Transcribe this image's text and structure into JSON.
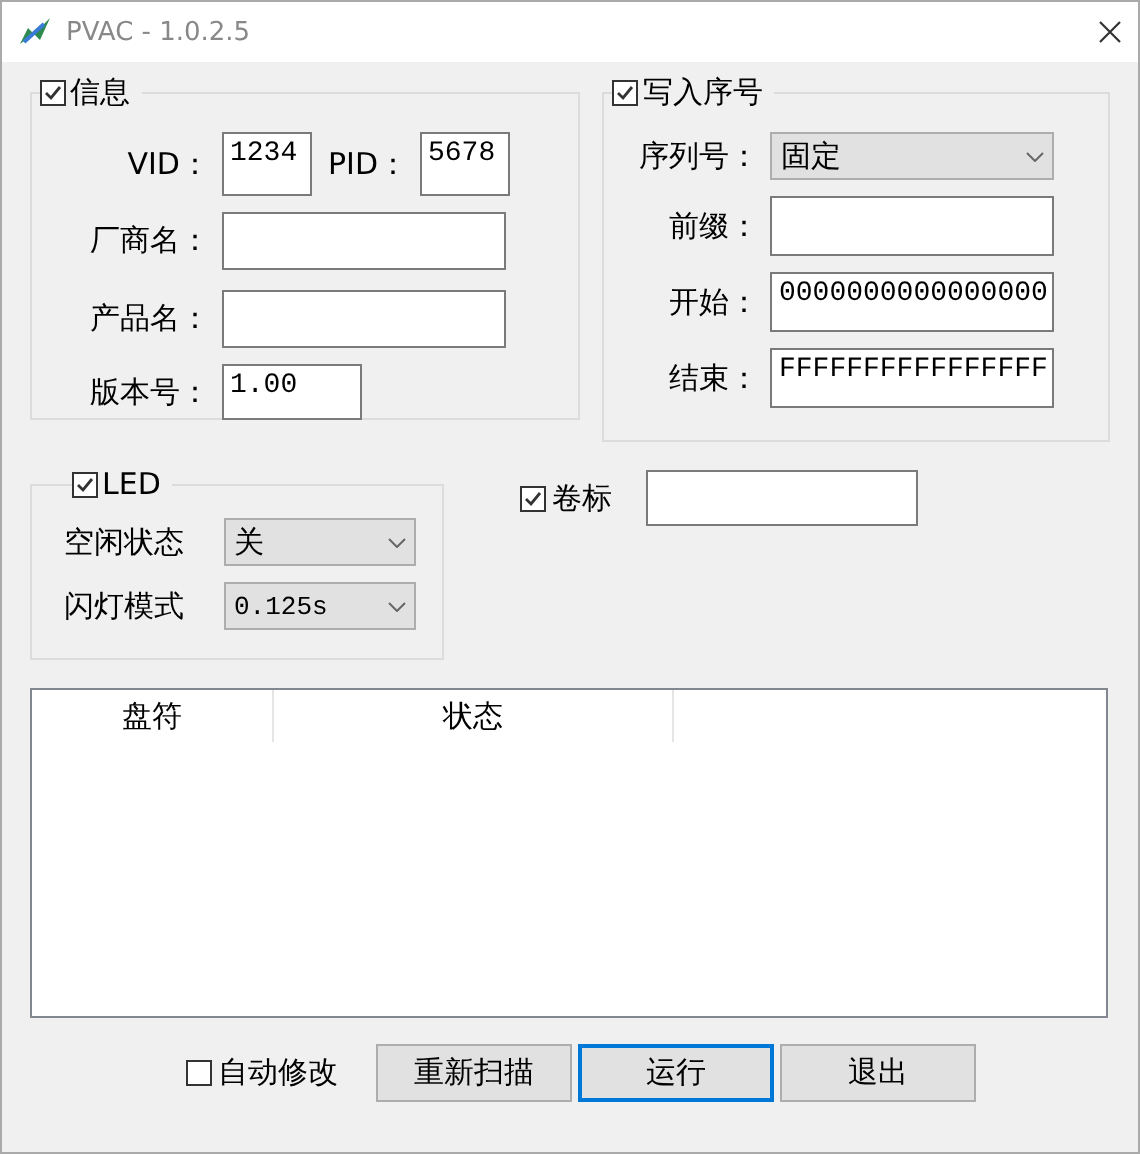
{
  "window": {
    "title": "PVAC - 1.0.2.5"
  },
  "info": {
    "label": "信息",
    "checked": true,
    "vid": {
      "label": "VID：",
      "value": "1234"
    },
    "pid": {
      "label": "PID：",
      "value": "5678"
    },
    "fields": [
      {
        "label": "厂商名："
      },
      {
        "label": "产品名："
      }
    ],
    "version": {
      "label": "版本号：",
      "value": "1.00"
    }
  },
  "serial": {
    "label": "写入序号",
    "checked": true,
    "rows": [
      {
        "kind": "select",
        "label": "序列号：",
        "value": "固定"
      },
      {
        "kind": "input",
        "label": "前缀："
      },
      {
        "kind": "input",
        "label": "开始：",
        "value": "0000000000000000"
      },
      {
        "kind": "input",
        "label": "结束：",
        "value": "FFFFFFFFFFFFFFFF"
      }
    ]
  },
  "led": {
    "label": "LED",
    "checked": true,
    "rows": [
      {
        "label": "空闲状态",
        "value": "关"
      },
      {
        "label": "闪灯模式",
        "value": "0.125s"
      }
    ]
  },
  "volume": {
    "label": "卷标",
    "checked": true
  },
  "list": {
    "columns": [
      "盘符",
      "状态"
    ]
  },
  "auto_modify": {
    "label": "自动修改",
    "checked": false
  },
  "buttons": [
    {
      "label": "重新扫描",
      "focused": false
    },
    {
      "label": "运行",
      "focused": true
    },
    {
      "label": "退出",
      "focused": false
    }
  ]
}
